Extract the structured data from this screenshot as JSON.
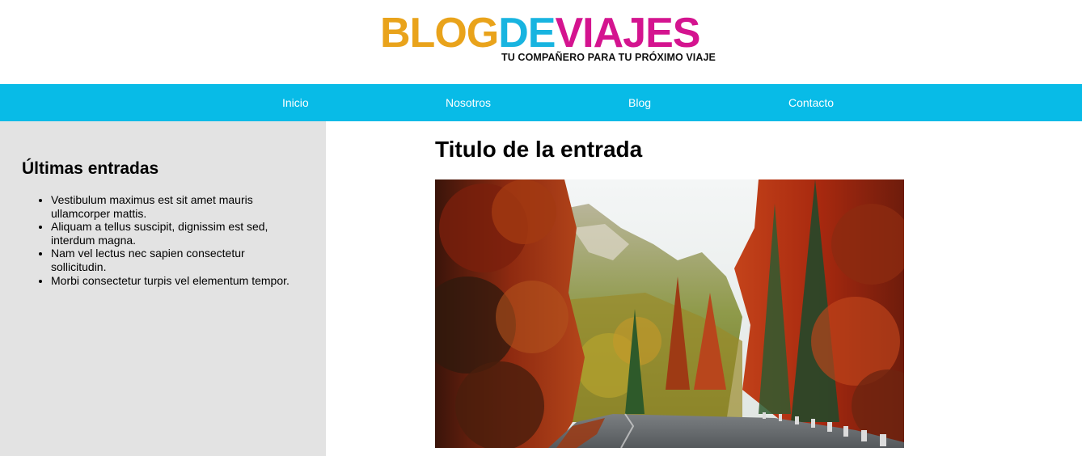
{
  "header": {
    "logo": {
      "part_blog": "BLOG",
      "part_de": "DE",
      "part_viajes": "VIAJES",
      "tagline": "TU COMPAÑERO PARA TU PRÓXIMO VIAJE"
    }
  },
  "nav": {
    "items": [
      {
        "label": "Inicio"
      },
      {
        "label": "Nosotros"
      },
      {
        "label": "Blog"
      },
      {
        "label": "Contacto"
      }
    ]
  },
  "sidebar": {
    "title": "Últimas entradas",
    "entries": [
      {
        "text": "Vestibulum maximus est sit amet mauris ullamcorper mattis."
      },
      {
        "text": "Aliquam a tellus suscipit, dignissim est sed, interdum magna."
      },
      {
        "text": "Nam vel lectus nec sapien consectetur sollicitudin."
      },
      {
        "text": "Morbi consectetur turpis vel elementum tempor."
      }
    ]
  },
  "main": {
    "post_title": "Titulo de la entrada",
    "post_image_icon": "autumn-forest-road-photo"
  },
  "colors": {
    "nav_background": "#08bbe7",
    "sidebar_background": "#e3e3e3",
    "logo_blog": "#e9a31b",
    "logo_de": "#18b4e0",
    "logo_viajes": "#d4148f"
  }
}
